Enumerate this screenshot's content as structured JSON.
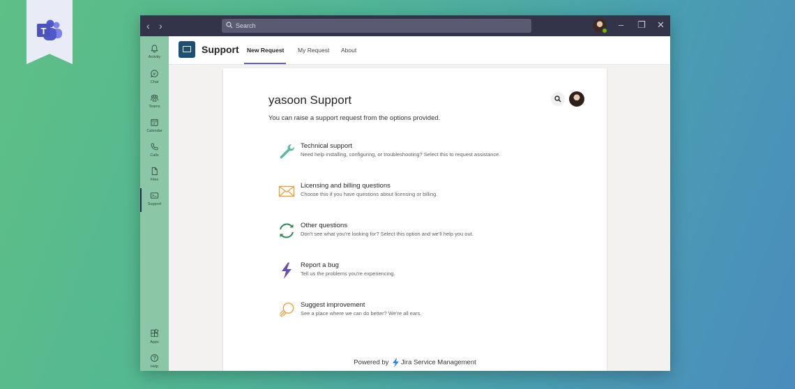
{
  "window": {
    "search_placeholder": "Search",
    "nav_back": "‹",
    "nav_forward": "›",
    "controls": {
      "minimize": "–",
      "restore": "❐",
      "close": "✕"
    }
  },
  "rail": {
    "items": [
      {
        "label": "Activity",
        "icon": "bell-icon"
      },
      {
        "label": "Chat",
        "icon": "chat-icon"
      },
      {
        "label": "Teams",
        "icon": "teams-icon"
      },
      {
        "label": "Calendar",
        "icon": "calendar-icon"
      },
      {
        "label": "Calls",
        "icon": "phone-icon"
      },
      {
        "label": "Files",
        "icon": "file-icon"
      },
      {
        "label": "Support",
        "icon": "support-icon",
        "active": true
      }
    ],
    "bottom": [
      {
        "label": "Apps",
        "icon": "apps-icon"
      },
      {
        "label": "Help",
        "icon": "help-icon"
      }
    ]
  },
  "app": {
    "title": "Support",
    "tabs": [
      {
        "label": "New Request",
        "active": true
      },
      {
        "label": "My Request"
      },
      {
        "label": "About"
      }
    ]
  },
  "portal": {
    "title": "yasoon Support",
    "subtitle": "You can raise a support request from the options provided.",
    "options": [
      {
        "title": "Technical support",
        "desc": "Need help installing, configuring, or troubleshooting? Select this to request assistance.",
        "icon": "wrench-icon",
        "color": "#5fb8a0"
      },
      {
        "title": "Licensing and billing questions",
        "desc": "Choose this if you have questions about licensing or billing.",
        "icon": "envelope-icon",
        "color": "#e3a23a"
      },
      {
        "title": "Other questions",
        "desc": "Don't see what you're looking for? Select this option and we'll help you out.",
        "icon": "refresh-icon",
        "color": "#2e8b57"
      },
      {
        "title": "Report a bug",
        "desc": "Tell us the problems you're experiencing.",
        "icon": "bolt-icon",
        "color": "#6b4fa8"
      },
      {
        "title": "Suggest improvement",
        "desc": "See a place where we can do better? We're all ears.",
        "icon": "lightbulb-icon",
        "color": "#e8a33a"
      }
    ],
    "powered_prefix": "Powered by",
    "powered_brand": "Jira Service Management",
    "brand_color": "#2684ff"
  }
}
